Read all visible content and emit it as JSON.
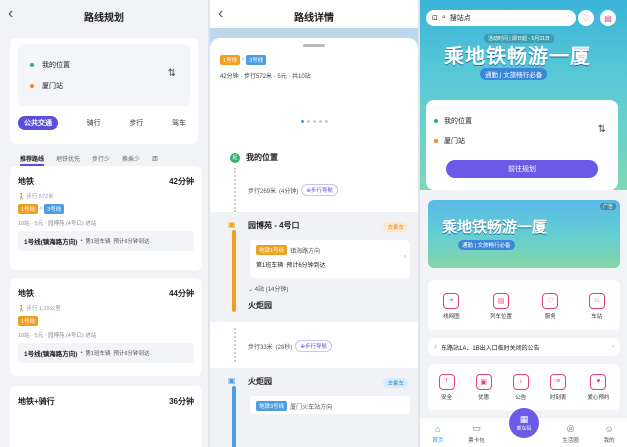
{
  "p1": {
    "title": "路线规划",
    "from": "我的位置",
    "to": "厦门站",
    "modes": [
      "公共交通",
      "骑行",
      "步行",
      "驾车"
    ],
    "prefs": [
      "推荐路线",
      "地铁优先",
      "步行少",
      "换乘少",
      "距"
    ],
    "routes": [
      {
        "name": "地铁",
        "time": "42分钟",
        "walk": "步行 572米",
        "lines": [
          "1号线",
          "3号线"
        ],
        "meta": "10站 · 5元 · 园博苑 (4号口) 进站",
        "line": "1号线(镇海路方向)",
        "first": "第1班车辆",
        "eta": "预计6分钟到达"
      },
      {
        "name": "地铁",
        "time": "44分钟",
        "walk": "步行 1.29公里",
        "lines": [
          "1号线"
        ],
        "meta": "10站 · 5元 · 园博苑 (4号口) 进站",
        "line": "1号线(镇海路方向)",
        "first": "第1班车辆",
        "eta": "预计6分钟到达"
      },
      {
        "name": "地铁+骑行",
        "time": "36分钟"
      }
    ]
  },
  "p2": {
    "title": "路线详情",
    "lines": [
      "1号线",
      "3号线"
    ],
    "summary": "42分钟 · 步行572米 · 5元 · 共10站",
    "start": "我的位置",
    "start_tag": "起",
    "walk1": "步行269米",
    "walk1_time": "(4分钟)",
    "walk_nav": "步行导航",
    "station1": "园博苑 - 4号口",
    "station1_tag": "去乘车",
    "line_badge": "地铁1号线",
    "line_dir": "镇海路方向",
    "train": "第1班车辆",
    "eta": "预计6分钟到达",
    "stops": "4站 (14分钟)",
    "transfer": "火炬园",
    "walk2": "步行33米",
    "walk2_time": "(28秒)",
    "station2": "火炬园",
    "station2_tag": "去乘车",
    "line2_badge": "地铁3号线",
    "line2_dir": "厦门火车站方向"
  },
  "p3": {
    "search": "搜站点",
    "date": "活动时间 | 即日起 - 5月31日",
    "slogan": "乘地铁畅游一厦",
    "slogan_sub": "通勤 | 文旅畅行必备",
    "from": "我的位置",
    "to": "厦门站",
    "plan_btn": "前往规划",
    "banner2_tag": "广告",
    "banner2_slogan": "乘地铁畅游一厦",
    "banner2_sub": "通勤 | 文旅畅行必备",
    "icons1": [
      {
        "label": "线网图",
        "glyph": "⌖"
      },
      {
        "label": "列车位置",
        "glyph": "▤"
      },
      {
        "label": "服务",
        "glyph": "♡"
      },
      {
        "label": "车站",
        "glyph": "⌂"
      }
    ],
    "notice": "东路站1A、1B出入口临时关闭的公告",
    "icons2": [
      {
        "label": "安全",
        "glyph": "!"
      },
      {
        "label": "优惠",
        "glyph": "▣"
      },
      {
        "label": "公告",
        "glyph": "♪"
      },
      {
        "label": "时刻表",
        "glyph": "≡"
      },
      {
        "label": "爱心预约",
        "glyph": "♥"
      }
    ],
    "tabs": [
      "首页",
      "票卡包",
      "乘车码",
      "生活圈",
      "我的"
    ]
  },
  "colors": {
    "accent": "#5a4fdc",
    "line1": "#f0a020",
    "line3": "#4b9fe0",
    "brand_pink": "#e2476f"
  }
}
